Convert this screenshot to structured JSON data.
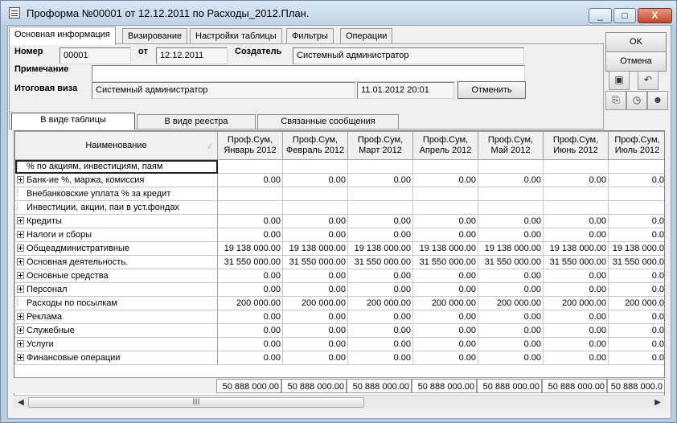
{
  "window": {
    "title": "Проформа №00001 от 12.12.2011 по Расходы_2012.План.",
    "controls": [
      "_",
      "□",
      "X"
    ]
  },
  "tabs": [
    "Основная информация",
    "Визирование",
    "Настройки таблицы",
    "Фильтры",
    "Операции"
  ],
  "form": {
    "number_label": "Номер",
    "number_value": "00001",
    "date_label": "от",
    "date_value": "12.12.2011",
    "creator_label": "Создатель",
    "creator_value": "Системный администратор",
    "note_label": "Примечание",
    "note_value": "",
    "visa_label": "Итоговая виза",
    "visa_value": "Системный администратор",
    "visa_datetime": "11.01.2012 20:01",
    "cancel_visa_button": "Отменить"
  },
  "actions": {
    "ok_button": "OK",
    "cancel_button": "Отмена",
    "icons": [
      "save-icon",
      "undo-icon",
      "attach-icon",
      "clock-icon",
      "user-info-icon"
    ]
  },
  "view_tabs": [
    "В виде таблицы",
    "В виде реестра",
    "Связанные сообщения"
  ],
  "grid": {
    "name_header": "Наименование",
    "columns": [
      "Проф.Сум, Январь 2012",
      "Проф.Сум, Февраль 2012",
      "Проф.Сум, Март 2012",
      "Проф.Сум, Апрель 2012",
      "Проф.Сум, Май 2012",
      "Проф.Сум, Июнь 2012",
      "Проф.Сум, Июль 2012"
    ],
    "rows": [
      {
        "name": "% по акциям, инвестициям, паям",
        "expand": false,
        "values": [
          "",
          "",
          "",
          "",
          "",
          "",
          ""
        ]
      },
      {
        "name": "Банк-ие %, маржа, комиссия",
        "expand": true,
        "values": [
          "0.00",
          "0.00",
          "0.00",
          "0.00",
          "0.00",
          "0.00",
          "0.0"
        ]
      },
      {
        "name": "Внебанковские уплата % за кредит",
        "expand": false,
        "values": [
          "",
          "",
          "",
          "",
          "",
          "",
          ""
        ]
      },
      {
        "name": "Инвестиции, акции, паи в уст.фондах",
        "expand": false,
        "values": [
          "",
          "",
          "",
          "",
          "",
          "",
          ""
        ]
      },
      {
        "name": "Кредиты",
        "expand": true,
        "values": [
          "0.00",
          "0.00",
          "0.00",
          "0.00",
          "0.00",
          "0.00",
          "0.0"
        ]
      },
      {
        "name": "Налоги и сборы",
        "expand": true,
        "values": [
          "0.00",
          "0.00",
          "0.00",
          "0.00",
          "0.00",
          "0.00",
          "0.0"
        ]
      },
      {
        "name": "Общеадминистративные",
        "expand": true,
        "values": [
          "19 138 000.00",
          "19 138 000.00",
          "19 138 000.00",
          "19 138 000.00",
          "19 138 000.00",
          "19 138 000.00",
          "19 138 000.0"
        ]
      },
      {
        "name": "Основная деятельность.",
        "expand": true,
        "values": [
          "31 550 000.00",
          "31 550 000.00",
          "31 550 000.00",
          "31 550 000.00",
          "31 550 000.00",
          "31 550 000.00",
          "31 550 000.0"
        ]
      },
      {
        "name": "Основные средства",
        "expand": true,
        "values": [
          "0.00",
          "0.00",
          "0.00",
          "0.00",
          "0.00",
          "0.00",
          "0.0"
        ]
      },
      {
        "name": "Персонал",
        "expand": true,
        "values": [
          "0.00",
          "0.00",
          "0.00",
          "0.00",
          "0.00",
          "0.00",
          "0.0"
        ]
      },
      {
        "name": "Расходы по посылкам",
        "expand": false,
        "values": [
          "200 000.00",
          "200 000.00",
          "200 000.00",
          "200 000.00",
          "200 000.00",
          "200 000.00",
          "200 000.0"
        ]
      },
      {
        "name": "Реклама",
        "expand": true,
        "values": [
          "0.00",
          "0.00",
          "0.00",
          "0.00",
          "0.00",
          "0.00",
          "0.0"
        ]
      },
      {
        "name": "Служебные",
        "expand": true,
        "values": [
          "0.00",
          "0.00",
          "0.00",
          "0.00",
          "0.00",
          "0.00",
          "0.0"
        ]
      },
      {
        "name": "Услуги",
        "expand": true,
        "values": [
          "0.00",
          "0.00",
          "0.00",
          "0.00",
          "0.00",
          "0.00",
          "0.0"
        ]
      },
      {
        "name": "Финансовые операции",
        "expand": true,
        "values": [
          "0.00",
          "0.00",
          "0.00",
          "0.00",
          "0.00",
          "0.00",
          "0.0"
        ]
      }
    ],
    "totals": [
      "50 888 000.00",
      "50 888 000.00",
      "50 888 000.00",
      "50 888 000.00",
      "50 888 000.00",
      "50 888 000.00",
      "50 888 000.0"
    ],
    "scroll_thumb_grip": "III",
    "scroll_left_arrow": "◀",
    "scroll_right_arrow": "▶"
  }
}
